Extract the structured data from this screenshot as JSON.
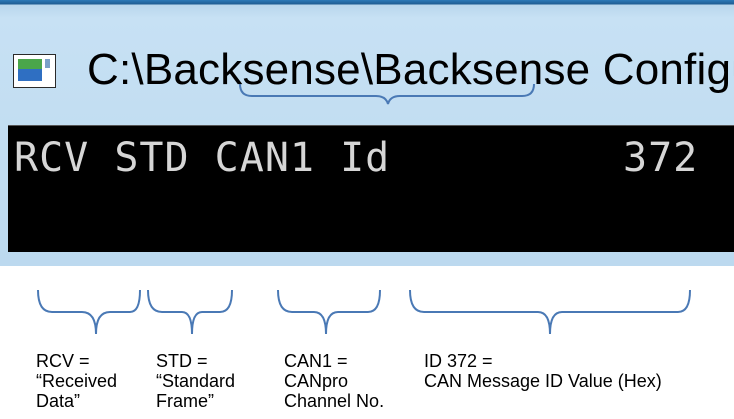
{
  "window": {
    "title": "C:\\Backsense\\Backsense Configu",
    "icon": "app-window-icon"
  },
  "console": {
    "line": "RCV STD CAN1 Id",
    "id_value": "372"
  },
  "annotations": [
    {
      "line1": "RCV =",
      "line2": "“Received",
      "line3": "Data”"
    },
    {
      "line1": "STD =",
      "line2": "“Standard",
      "line3": "Frame”"
    },
    {
      "line1": "CAN1 =",
      "line2": "CANpro",
      "line3": "Channel No."
    },
    {
      "line1": "ID  372 =",
      "line2": "CAN Message ID Value (Hex)",
      "line3": ""
    }
  ],
  "colors": {
    "title_bar": "#c7e1f4",
    "console_bg": "#000000",
    "console_text": "#d6d6d6",
    "brace": "#4a79b5"
  }
}
